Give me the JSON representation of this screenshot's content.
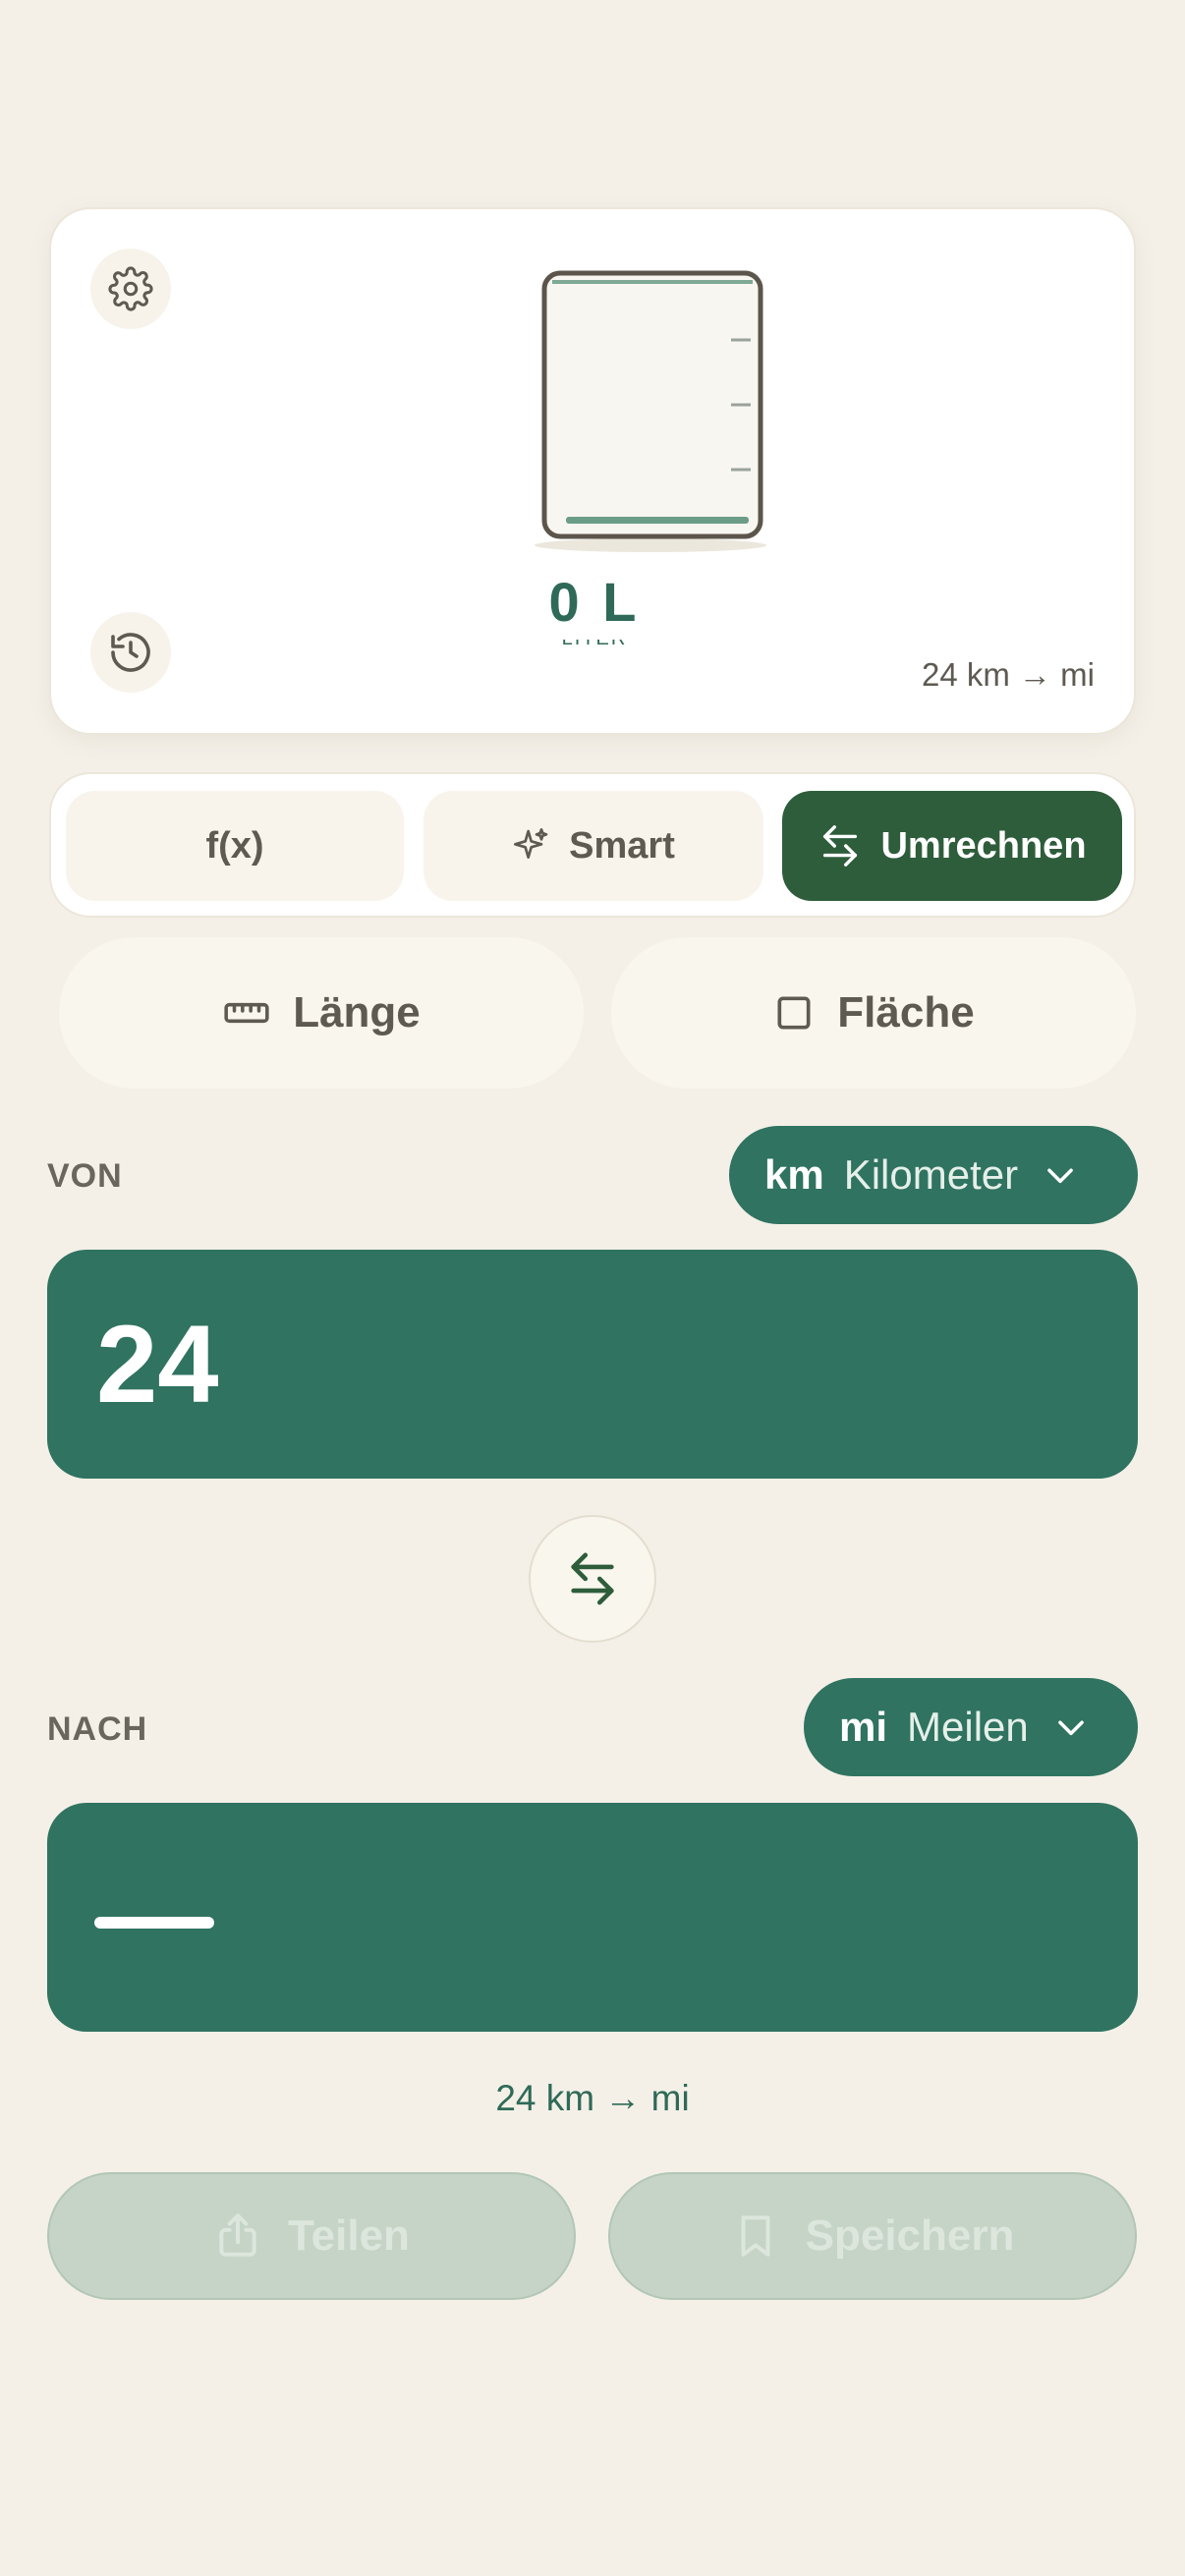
{
  "hero": {
    "settings_icon": "gear-icon",
    "history_icon": "history-icon",
    "illustration": "measuring-cup-icon",
    "amount": "0 L",
    "amount_sub": "LITER",
    "expression": "24 km → mi"
  },
  "modes": [
    {
      "label": "f(x)",
      "icon": "",
      "active": false
    },
    {
      "label": "Smart",
      "icon": "sparkle-icon",
      "active": false
    },
    {
      "label": "Umrechnen",
      "icon": "swap-arrows-icon",
      "active": true
    }
  ],
  "categories": [
    {
      "label": "Länge",
      "icon": "ruler-icon"
    },
    {
      "label": "Fläche",
      "icon": "square-icon"
    }
  ],
  "from": {
    "label": "VON",
    "unit_abbr": "km",
    "unit_name": "Kilometer",
    "value": "24"
  },
  "to": {
    "label": "NACH",
    "unit_abbr": "mi",
    "unit_name": "Meilen",
    "value": "—"
  },
  "result_expression": "24 km → mi",
  "actions": {
    "share_label": "Teilen",
    "save_label": "Speichern"
  },
  "colors": {
    "background": "#f4f0e8",
    "accent": "#2f7360",
    "active_mode": "#2e5d3b",
    "disabled_action": "#c5d4c7"
  }
}
